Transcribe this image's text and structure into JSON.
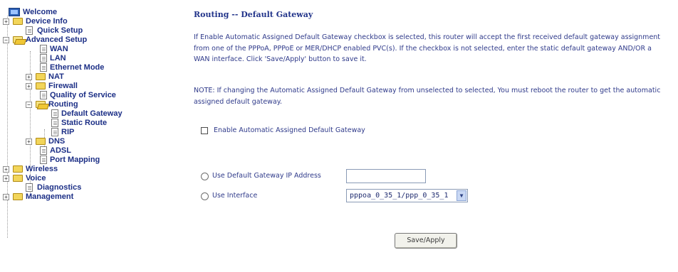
{
  "nav": {
    "welcome": "Welcome",
    "device_info": "Device Info",
    "quick_setup": "Quick Setup",
    "advanced_setup": "Advanced Setup",
    "wan": "WAN",
    "lan": "LAN",
    "ethernet_mode": "Ethernet Mode",
    "nat": "NAT",
    "firewall": "Firewall",
    "qos": "Quality of Service",
    "routing": "Routing",
    "default_gateway": "Default Gateway",
    "static_route": "Static Route",
    "rip": "RIP",
    "dns": "DNS",
    "adsl": "ADSL",
    "port_mapping": "Port Mapping",
    "wireless": "Wireless",
    "voice": "Voice",
    "diagnostics": "Diagnostics",
    "management": "Management",
    "expand_symbol": "+",
    "collapse_symbol": "−"
  },
  "page": {
    "title": "Routing -- Default Gateway",
    "intro": "If Enable Automatic Assigned Default Gateway checkbox is selected, this router will accept the first received default gateway assignment from one of the PPPoA, PPPoE or MER/DHCP enabled PVC(s). If the checkbox is not selected, enter the static default gateway AND/OR a WAN interface. Click 'Save/Apply' button to save it.",
    "note": "NOTE: If changing the Automatic Assigned Default Gateway from unselected to selected, You must reboot the router to get the automatic assigned default gateway.",
    "enable_auto_label": "Enable Automatic Assigned Default Gateway",
    "use_gateway_ip_label": "Use Default Gateway IP Address",
    "gateway_ip_value": "",
    "use_interface_label": "Use Interface",
    "interface_selected": "pppoa_0_35_1/ppp_0_35_1",
    "save_button": "Save/Apply"
  }
}
